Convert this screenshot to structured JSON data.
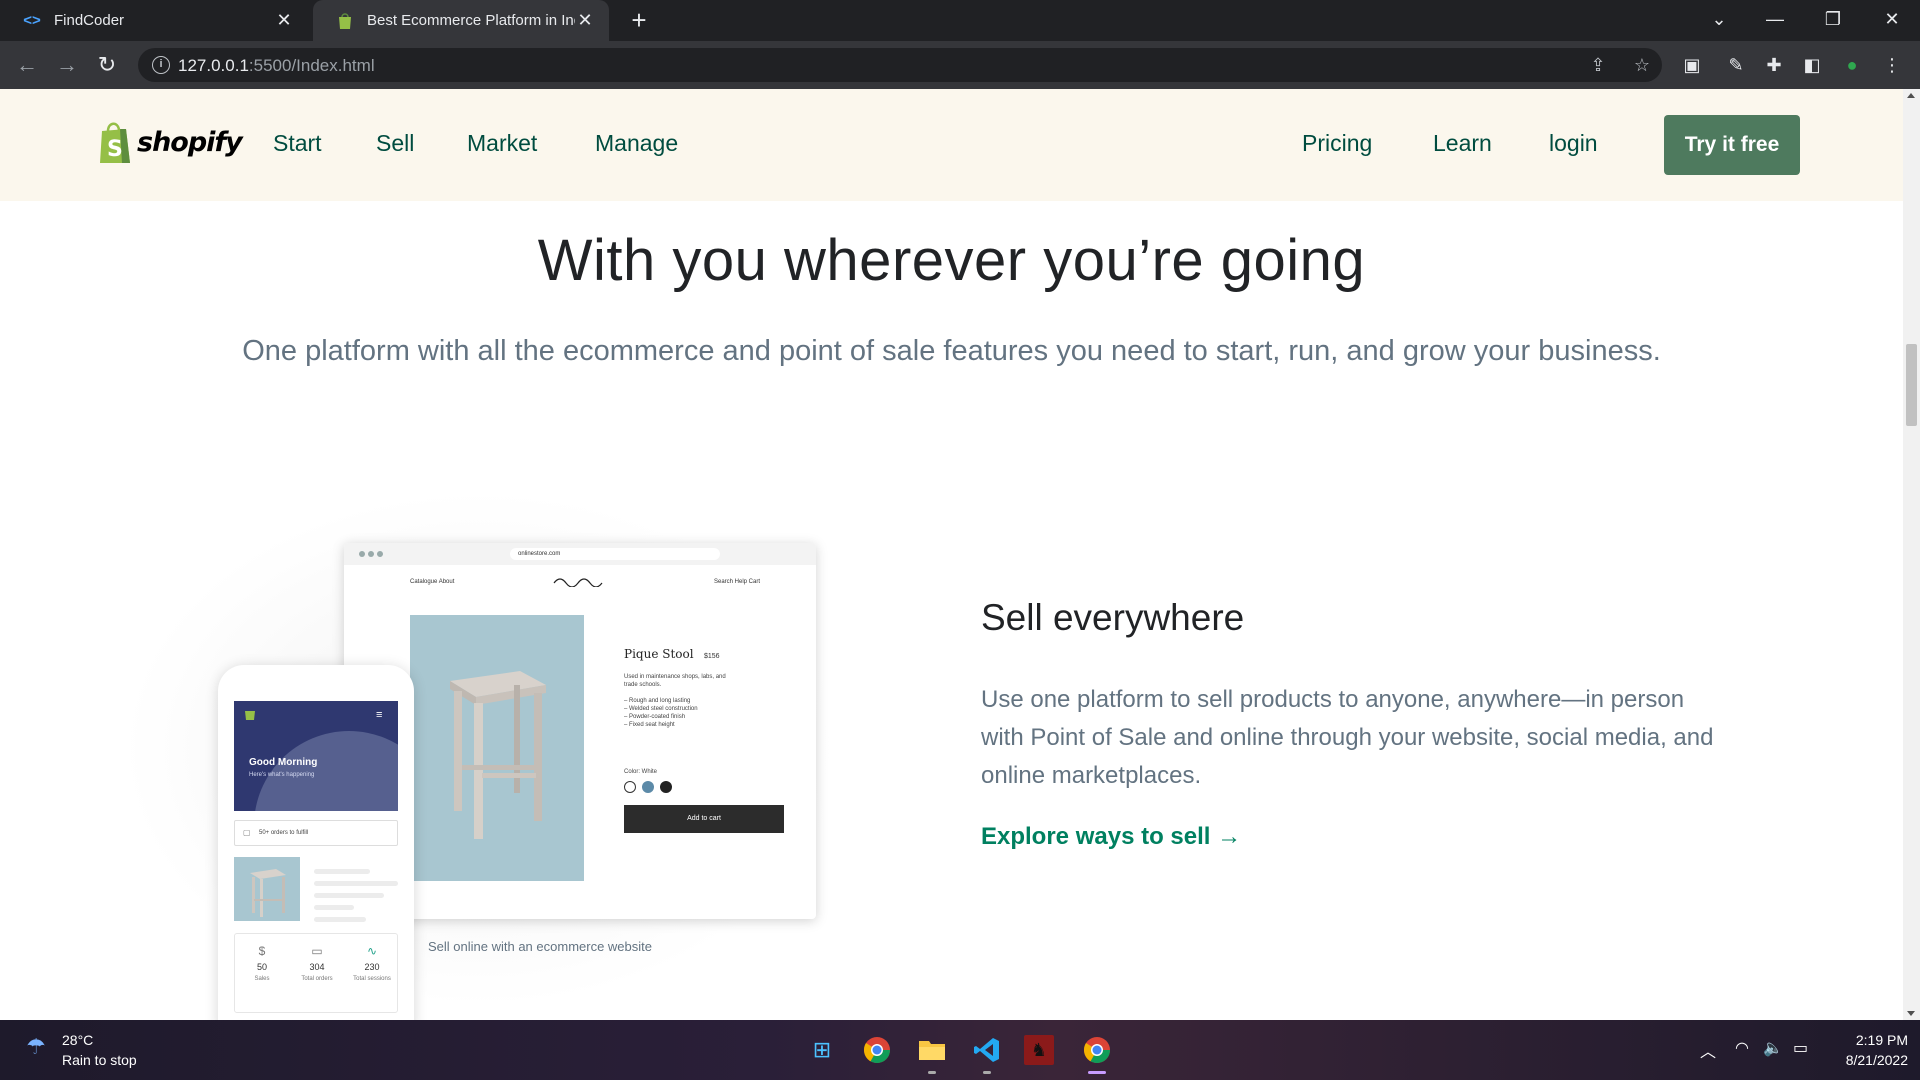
{
  "browser": {
    "tabs": [
      {
        "title": "FindCoder",
        "active": false
      },
      {
        "title": "Best Ecommerce Platform in Indi",
        "active": true
      }
    ],
    "url_host": "127.0.0.1",
    "url_path": ":5500/Index.html"
  },
  "site": {
    "brand": "shopify",
    "nav_left": [
      "Start",
      "Sell",
      "Market",
      "Manage"
    ],
    "nav_right": [
      "Pricing",
      "Learn",
      "login"
    ],
    "cta": "Try it free"
  },
  "hero": {
    "title": "With you wherever you’re going",
    "subtitle": "One platform with all the ecommerce and point of sale features you need to start, run, and grow your business."
  },
  "illustration": {
    "store_url": "onlinestore.com",
    "topnav_left": "Catalogue   About",
    "topnav_right": "Search   Help   Cart",
    "product_title": "Pique Stool",
    "product_price": "$156",
    "product_text": "Used in maintenance shops, labs, and trade schools.\n\n– Rough and long lasting\n– Welded steel construction\n– Powder-coated finish\n– Fixed seat height",
    "color_label": "Color: White",
    "add_to_cart": "Add to cart",
    "phone_greeting": "Good Morning",
    "phone_greeting_sub": "Here's what's happening",
    "phone_orders": "50+ orders to fulfill",
    "stats": [
      {
        "value": "50",
        "label": "Sales"
      },
      {
        "value": "304",
        "label": "Total orders"
      },
      {
        "value": "230",
        "label": "Total sessions"
      }
    ],
    "caption": "Sell online with an ecommerce website"
  },
  "sell": {
    "title": "Sell everywhere",
    "body": "Use one platform to sell products to anyone, anywhere—in person with Point of Sale and online through your website, social media, and online marketplaces.",
    "link": "Explore ways to sell →"
  },
  "taskbar": {
    "temp": "28°C",
    "weather": "Rain to stop",
    "time": "2:19 PM",
    "date": "8/21/2022"
  },
  "colors": {
    "header_bg": "#fbf7ed",
    "nav_text": "#004c3f",
    "cta_bg": "#4e7a5e",
    "link": "#008060"
  }
}
